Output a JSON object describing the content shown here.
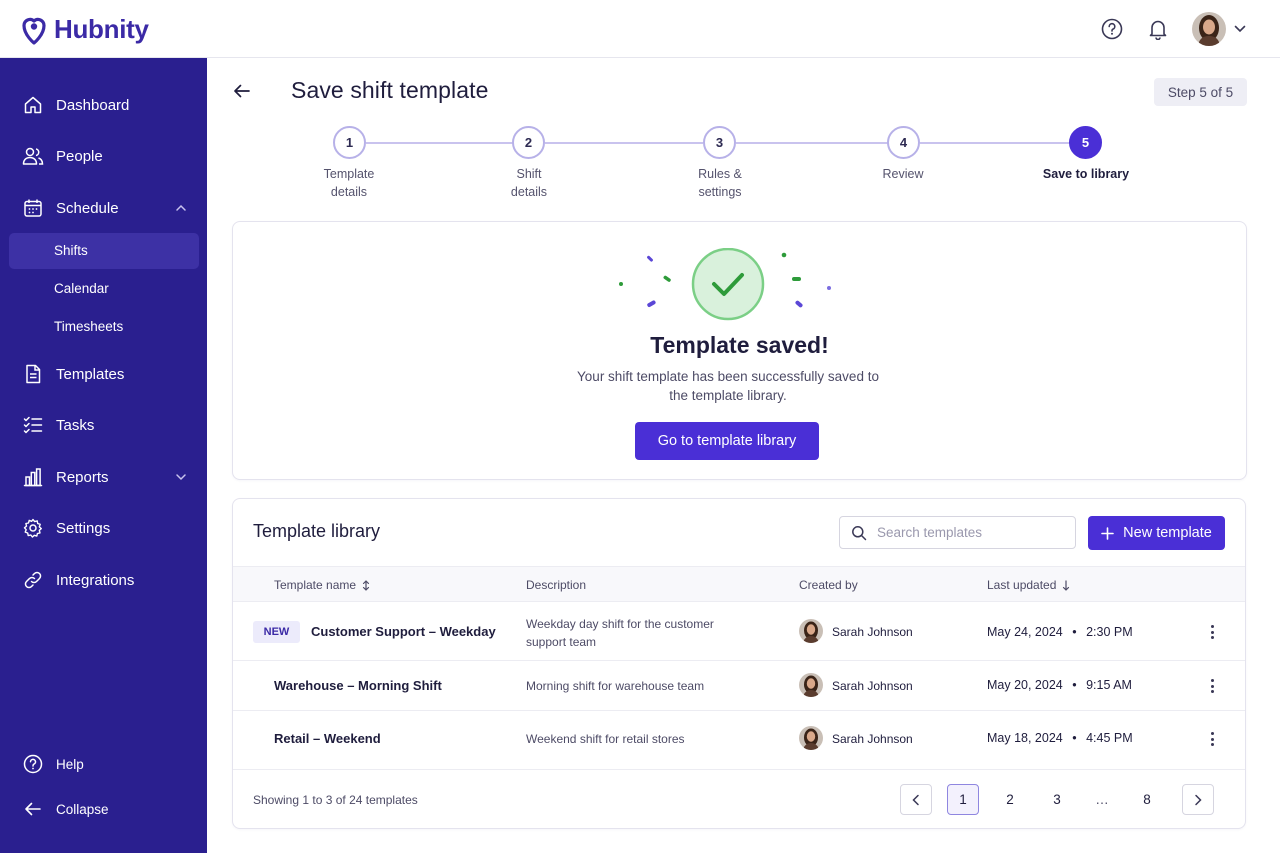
{
  "app": {
    "name": "Hubnity"
  },
  "colors": {
    "primary": "#4a2fd6",
    "sidebar": "#2a1f8f",
    "success": "#2e9b3a"
  },
  "header": {
    "icons": [
      "help-icon",
      "bell-icon"
    ]
  },
  "sidebar": {
    "items": [
      {
        "label": "Dashboard",
        "icon": "home-icon"
      },
      {
        "label": "People",
        "icon": "people-icon"
      },
      {
        "label": "Schedule",
        "icon": "calendar-icon"
      },
      {
        "label": "Templates",
        "icon": "document-icon"
      },
      {
        "label": "Tasks",
        "icon": "checklist-icon"
      },
      {
        "label": "Reports",
        "icon": "bar-chart-icon"
      },
      {
        "label": "Settings",
        "icon": "gear-icon"
      },
      {
        "label": "Integrations",
        "icon": "link-icon"
      }
    ],
    "schedule_sub": [
      "Shifts",
      "Calendar",
      "Timesheets"
    ],
    "active_sub": "Shifts",
    "help": "Help",
    "collapse": "Collapse"
  },
  "page": {
    "title": "Save shift template",
    "step_badge": "Step 5 of 5"
  },
  "stepper": {
    "current": 5,
    "steps": [
      {
        "number": "1",
        "label": "Template details"
      },
      {
        "number": "2",
        "label": "Shift details"
      },
      {
        "number": "3",
        "label": "Rules & settings"
      },
      {
        "number": "4",
        "label": "Review"
      },
      {
        "number": "5",
        "label": "Save to library"
      }
    ]
  },
  "success": {
    "title": "Template saved!",
    "description": "Your shift template has been successfully saved to the template library.",
    "button": "Go to template library"
  },
  "library": {
    "title": "Template library",
    "search_placeholder": "Search templates",
    "search_value": "",
    "new_button": "New template",
    "columns": [
      "Template name",
      "Description",
      "Created by",
      "Last updated"
    ],
    "rows": [
      {
        "badge": "NEW",
        "name": "Customer Support – Weekday",
        "description": "Weekday day shift for the customer support team",
        "created_by": "Sarah Johnson",
        "date": "May 24, 2024",
        "time": "2:30 PM"
      },
      {
        "badge": "",
        "name": "Warehouse – Morning Shift",
        "description": "Morning shift for warehouse team",
        "created_by": "Sarah Johnson",
        "date": "May 20, 2024",
        "time": "9:15 AM"
      },
      {
        "badge": "",
        "name": "Retail – Weekend",
        "description": "Weekend shift for retail stores",
        "created_by": "Sarah Johnson",
        "date": "May 18, 2024",
        "time": "4:45 PM"
      }
    ],
    "footer": "Showing 1 to 3 of 24 templates",
    "pagination": {
      "pages": [
        "1",
        "2",
        "3",
        "…",
        "8"
      ],
      "current": "1"
    },
    "separator": "•"
  }
}
